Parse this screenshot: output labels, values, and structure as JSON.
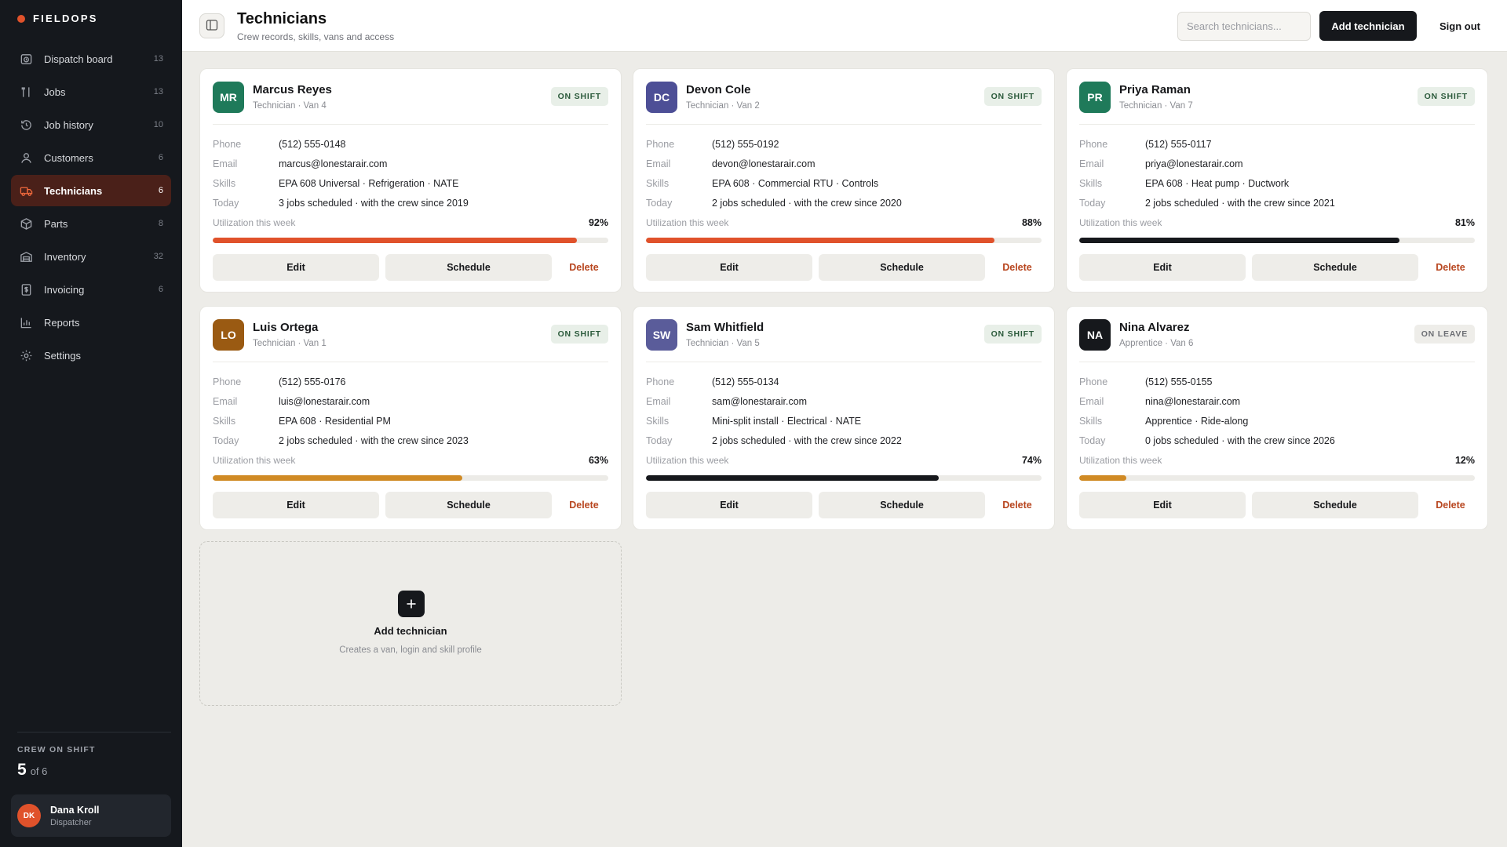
{
  "brand": {
    "name": "FIELDOPS"
  },
  "sidebar": {
    "items": [
      {
        "label": "Dispatch board",
        "count": "13",
        "icon": "clock-icon"
      },
      {
        "label": "Jobs",
        "count": "13",
        "icon": "tools-icon"
      },
      {
        "label": "Job history",
        "count": "10",
        "icon": "history-icon"
      },
      {
        "label": "Customers",
        "count": "6",
        "icon": "user-icon"
      },
      {
        "label": "Technicians",
        "count": "6",
        "icon": "truck-icon",
        "active": true
      },
      {
        "label": "Parts",
        "count": "8",
        "icon": "box-icon"
      },
      {
        "label": "Inventory",
        "count": "32",
        "icon": "warehouse-icon"
      },
      {
        "label": "Invoicing",
        "count": "6",
        "icon": "invoice-icon"
      },
      {
        "label": "Reports",
        "count": "",
        "icon": "chart-icon"
      },
      {
        "label": "Settings",
        "count": "",
        "icon": "gear-icon"
      }
    ],
    "crew": {
      "label": "CREW ON SHIFT",
      "count": "5",
      "of": "of 6"
    },
    "user": {
      "initials": "DK",
      "name": "Dana Kroll",
      "role": "Dispatcher"
    }
  },
  "header": {
    "title": "Technicians",
    "subtitle": "Crew records, skills, vans and access",
    "search_placeholder": "Search technicians...",
    "add_label": "Add technician",
    "signout_label": "Sign out"
  },
  "labels": {
    "phone": "Phone",
    "email": "Email",
    "skills": "Skills",
    "today": "Today",
    "utilization": "Utilization this week",
    "edit": "Edit",
    "schedule": "Schedule",
    "delete": "Delete"
  },
  "technicians": [
    {
      "initials": "MR",
      "name": "Marcus Reyes",
      "role": "Technician · Van 4",
      "status": "ON SHIFT",
      "phone": "(512) 555-0148",
      "email": "marcus@lonestarair.com",
      "skills": "EPA 608 Universal · Refrigeration · NATE",
      "today": "3 jobs scheduled · with the crew since 2019",
      "utilization": 92,
      "utilization_text": "92%",
      "avatar_color": "#1f7a5a",
      "bar_color": "#e0522b"
    },
    {
      "initials": "DC",
      "name": "Devon Cole",
      "role": "Technician · Van 2",
      "status": "ON SHIFT",
      "phone": "(512) 555-0192",
      "email": "devon@lonestarair.com",
      "skills": "EPA 608 · Commercial RTU · Controls",
      "today": "2 jobs scheduled · with the crew since 2020",
      "utilization": 88,
      "utilization_text": "88%",
      "avatar_color": "#4d4f96",
      "bar_color": "#e0522b"
    },
    {
      "initials": "PR",
      "name": "Priya Raman",
      "role": "Technician · Van 7",
      "status": "ON SHIFT",
      "phone": "(512) 555-0117",
      "email": "priya@lonestarair.com",
      "skills": "EPA 608 · Heat pump · Ductwork",
      "today": "2 jobs scheduled · with the crew since 2021",
      "utilization": 81,
      "utilization_text": "81%",
      "avatar_color": "#1f7a5a",
      "bar_color": "#16181c"
    },
    {
      "initials": "LO",
      "name": "Luis Ortega",
      "role": "Technician · Van 1",
      "status": "ON SHIFT",
      "phone": "(512) 555-0176",
      "email": "luis@lonestarair.com",
      "skills": "EPA 608 · Residential PM",
      "today": "2 jobs scheduled · with the crew since 2023",
      "utilization": 63,
      "utilization_text": "63%",
      "avatar_color": "#9a5a12",
      "bar_color": "#d08a24"
    },
    {
      "initials": "SW",
      "name": "Sam Whitfield",
      "role": "Technician · Van 5",
      "status": "ON SHIFT",
      "phone": "(512) 555-0134",
      "email": "sam@lonestarair.com",
      "skills": "Mini-split install · Electrical · NATE",
      "today": "2 jobs scheduled · with the crew since 2022",
      "utilization": 74,
      "utilization_text": "74%",
      "avatar_color": "#5a5c9a",
      "bar_color": "#16181c"
    },
    {
      "initials": "NA",
      "name": "Nina Alvarez",
      "role": "Apprentice · Van 6",
      "status": "ON LEAVE",
      "phone": "(512) 555-0155",
      "email": "nina@lonestarair.com",
      "skills": "Apprentice · Ride-along",
      "today": "0 jobs scheduled · with the crew since 2026",
      "utilization": 12,
      "utilization_text": "12%",
      "avatar_color": "#16181c",
      "bar_color": "#d08a24"
    }
  ],
  "add_card": {
    "title": "Add technician",
    "subtitle": "Creates a van, login and skill profile"
  }
}
